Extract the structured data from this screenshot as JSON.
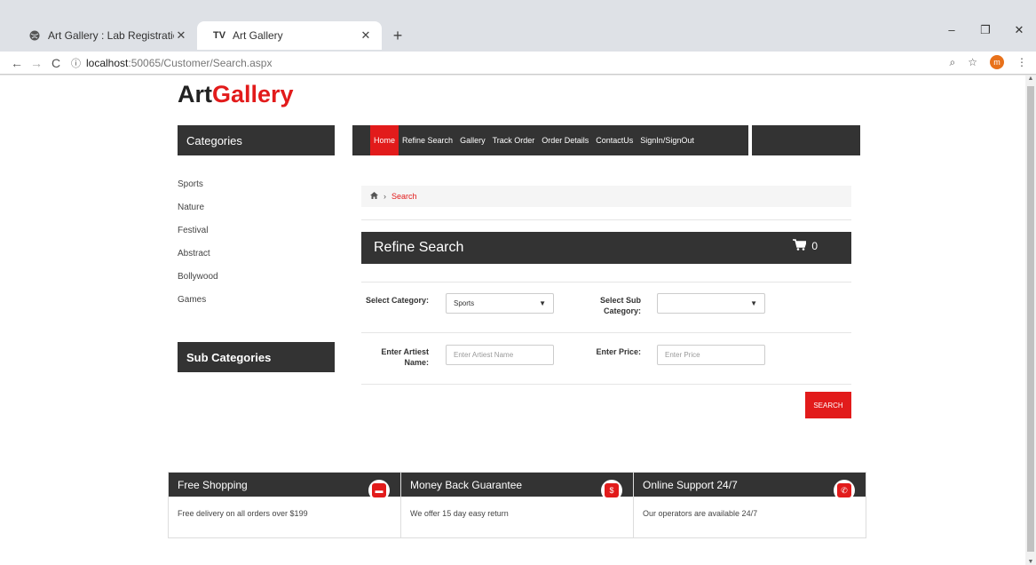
{
  "browser": {
    "tabs": [
      {
        "title": "Art Gallery : Lab Registration",
        "favicon": "globe-icon"
      },
      {
        "title": "Art Gallery",
        "favicon": "TV"
      }
    ],
    "url_host": "localhost",
    "url_path": ":50065/Customer/Search.aspx",
    "avatar_letter": "m"
  },
  "logo": {
    "part1": "Art",
    "part2": "Gallery"
  },
  "sidebar": {
    "categories_title": "Categories",
    "categories": [
      "Sports",
      "Nature",
      "Festival",
      "Abstract",
      "Bollywood",
      "Games"
    ],
    "subcategories_title": "Sub Categories"
  },
  "nav": {
    "items": [
      "Home",
      "Refine Search",
      "Gallery",
      "Track Order",
      "Order Details",
      "ContactUs",
      "SignIn/SignOut"
    ]
  },
  "breadcrumb": {
    "current": "Search"
  },
  "refine": {
    "title": "Refine Search",
    "cart_count": "0",
    "category_label": "Select Category:",
    "category_value": "Sports",
    "subcategory_label": "Select Sub Category:",
    "subcategory_value": "",
    "artist_label": "Enter Artiest Name:",
    "artist_placeholder": "Enter Artiest Name",
    "price_label": "Enter Price:",
    "price_placeholder": "Enter Price",
    "search_button": "SEARCH"
  },
  "features": [
    {
      "title": "Free Shopping",
      "desc": "Free delivery on all orders over $199",
      "icon": "truck-icon"
    },
    {
      "title": "Money Back Guarantee",
      "desc": "We offer 15 day easy return",
      "icon": "money-icon"
    },
    {
      "title": "Online Support 24/7",
      "desc": "Our operators are available 24/7",
      "icon": "phone-icon"
    }
  ],
  "colors": {
    "accent": "#e21b1b",
    "dark": "#333333"
  }
}
